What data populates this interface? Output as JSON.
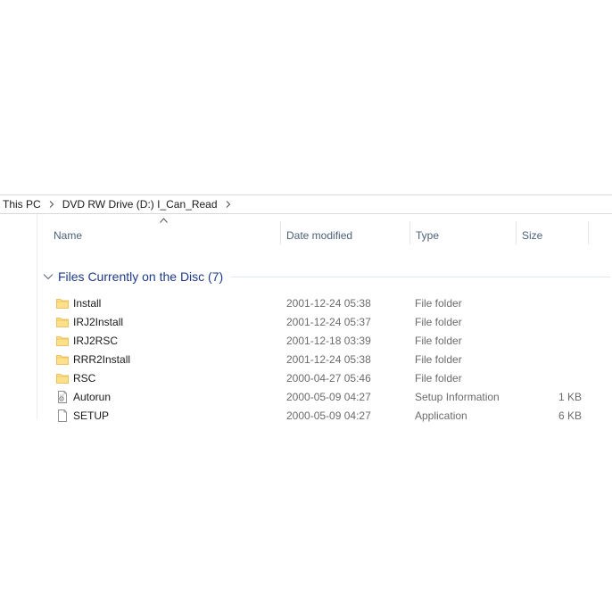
{
  "breadcrumb": {
    "items": [
      "This PC",
      "DVD RW Drive (D:) I_Can_Read"
    ]
  },
  "columns": {
    "name": "Name",
    "date_modified": "Date modified",
    "type": "Type",
    "size": "Size"
  },
  "group": {
    "title": "Files Currently on the Disc (7)"
  },
  "files": [
    {
      "name": "Install",
      "date": "2001-12-24 05:38",
      "type": "File folder",
      "size": "",
      "icon": "folder-icon"
    },
    {
      "name": "IRJ2Install",
      "date": "2001-12-24 05:37",
      "type": "File folder",
      "size": "",
      "icon": "folder-icon"
    },
    {
      "name": "IRJ2RSC",
      "date": "2001-12-18 03:39",
      "type": "File folder",
      "size": "",
      "icon": "folder-icon"
    },
    {
      "name": "RRR2Install",
      "date": "2001-12-24 05:38",
      "type": "File folder",
      "size": "",
      "icon": "folder-icon"
    },
    {
      "name": "RSC",
      "date": "2000-04-27 05:46",
      "type": "File folder",
      "size": "",
      "icon": "folder-icon"
    },
    {
      "name": "Autorun",
      "date": "2000-05-09 04:27",
      "type": "Setup Information",
      "size": "1 KB",
      "icon": "setup-info-icon"
    },
    {
      "name": "SETUP",
      "date": "2000-05-09 04:27",
      "type": "Application",
      "size": "6 KB",
      "icon": "application-icon"
    }
  ],
  "colors": {
    "folder_fill": "#ffe08a",
    "folder_edge": "#e3b64a",
    "group_title": "#1e3a8a",
    "header_text": "#4c607a"
  }
}
